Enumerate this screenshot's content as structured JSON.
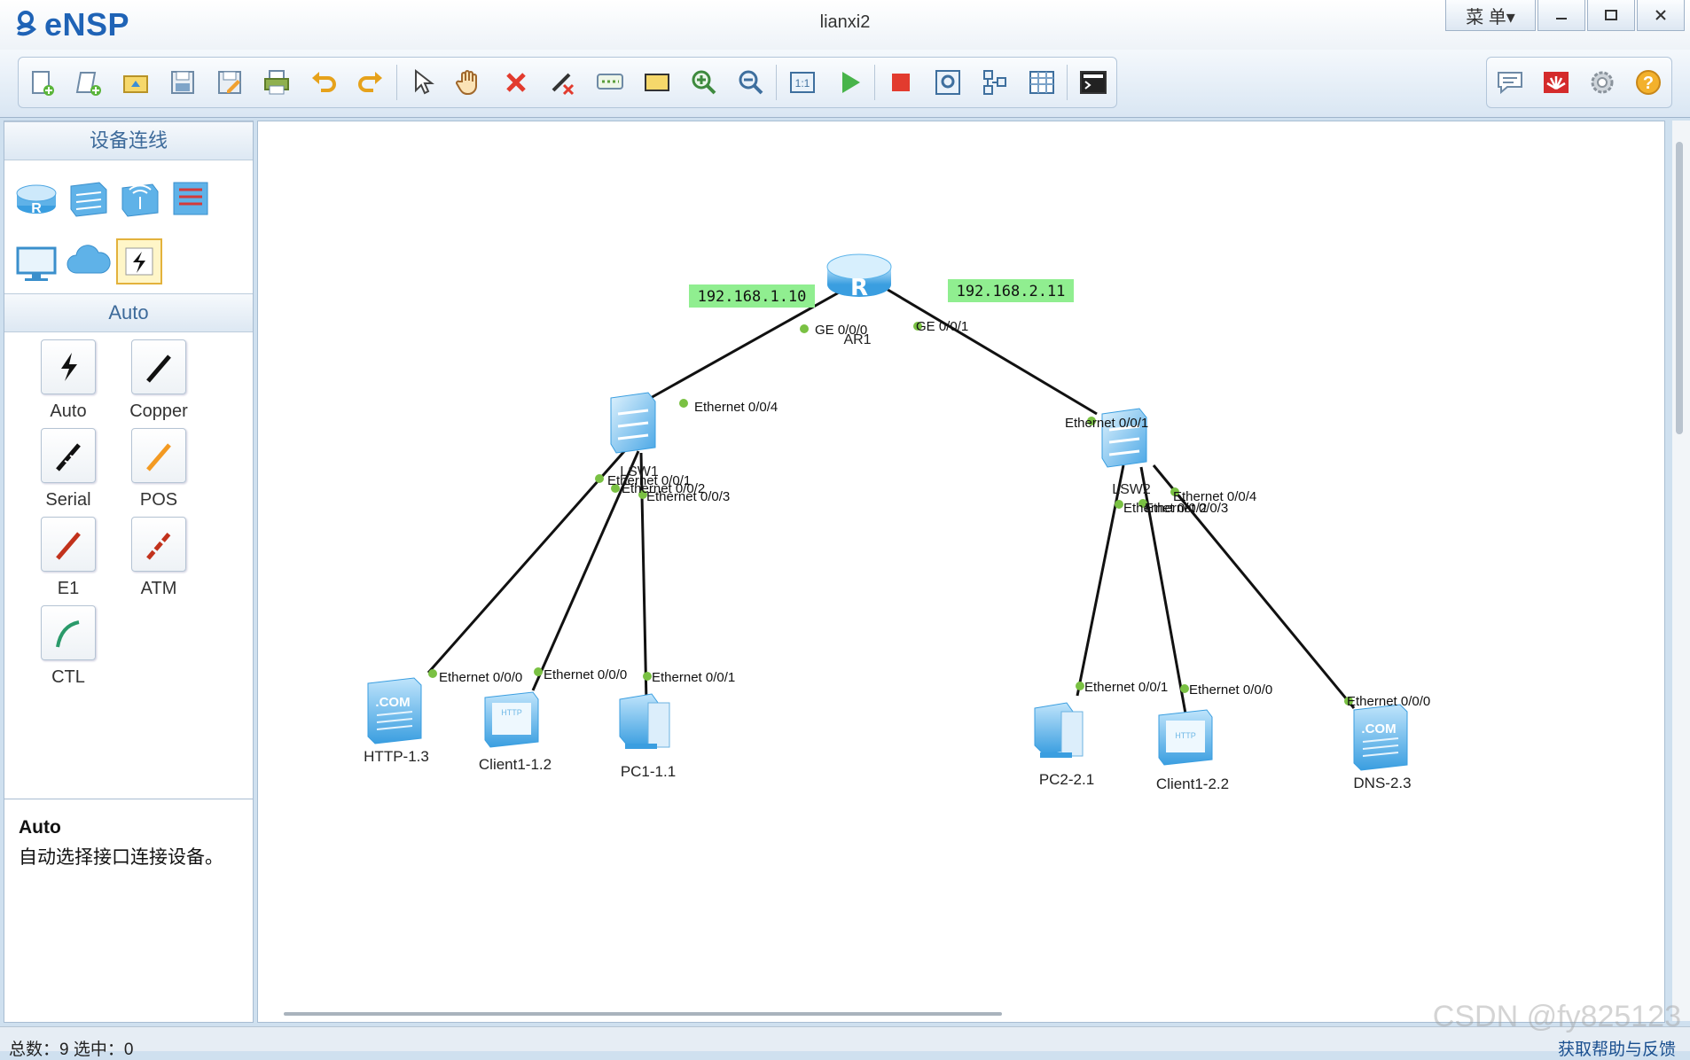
{
  "window": {
    "title": "lianxi2",
    "app_name": "eNSP",
    "menu_label": "菜 单▾"
  },
  "colors": {
    "accent": "#1f63b6",
    "ip_label_bg": "#90ee90",
    "link_dot": "#7ac143",
    "link_line": "#111111"
  },
  "toolbar": {
    "main_icons": [
      "new-topology-icon",
      "new-example-icon",
      "open-icon",
      "save-icon",
      "save-as-icon",
      "print-icon",
      "undo-icon",
      "redo-icon",
      "select-icon",
      "pan-hand-icon",
      "delete-icon",
      "delete-link-icon",
      "text-annotation-icon",
      "rectangle-icon",
      "zoom-in-icon",
      "zoom-out-icon",
      "fit-view-icon",
      "start-device-icon",
      "stop-device-icon",
      "capture-icon",
      "topology-view-icon",
      "grid-icon",
      "console-icon"
    ],
    "right_icons": [
      "chat-icon",
      "huawei-icon",
      "settings-icon",
      "help-icon"
    ]
  },
  "left_panel": {
    "device_header": "设备连线",
    "device_icons": [
      "router-icon",
      "switch-icon",
      "wireless-icon",
      "firewall-icon",
      "pc-terminal-icon",
      "cloud-icon",
      "link-auto-icon"
    ],
    "cable_header": "Auto",
    "cables": [
      {
        "label": "Auto",
        "icon": "auto-cable-icon"
      },
      {
        "label": "Copper",
        "icon": "copper-cable-icon"
      },
      {
        "label": "Serial",
        "icon": "serial-cable-icon"
      },
      {
        "label": "POS",
        "icon": "pos-cable-icon"
      },
      {
        "label": "E1",
        "icon": "e1-cable-icon"
      },
      {
        "label": "ATM",
        "icon": "atm-cable-icon"
      },
      {
        "label": "CTL",
        "icon": "ctl-cable-icon"
      }
    ],
    "description": {
      "title": "Auto",
      "text": "自动选择接口连接设备。"
    }
  },
  "topology": {
    "ip_labels": [
      "192.168.1.10",
      "192.168.2.11"
    ],
    "devices": {
      "ar1": {
        "name": "AR1",
        "type": "router"
      },
      "lsw1": {
        "name": "LSW1",
        "type": "switch"
      },
      "lsw2": {
        "name": "LSW2",
        "type": "switch"
      },
      "http": {
        "name": "HTTP-1.3",
        "type": "server"
      },
      "client11": {
        "name": "Client1-1.2",
        "type": "client"
      },
      "pc11": {
        "name": "PC1-1.1",
        "type": "pc"
      },
      "pc21": {
        "name": "PC2-2.1",
        "type": "pc"
      },
      "client22": {
        "name": "Client1-2.2",
        "type": "client"
      },
      "dns": {
        "name": "DNS-2.3",
        "type": "server"
      }
    },
    "ports": [
      "GE 0/0/0",
      "GE 0/0/1",
      "Ethernet 0/0/4",
      "Ethernet 0/0/1",
      "Ethernet 0/0/1",
      "Ethernet 0/0/2",
      "Ethernet 0/0/3",
      "Ethernet 0/0/0",
      "Ethernet 0/0/0",
      "Ethernet 0/0/1",
      "Ethernet 0/0/4",
      "Ethernet 0/0/2",
      "Ethernet 0/0/3",
      "Ethernet 0/0/1",
      "Ethernet 0/0/0",
      "Ethernet 0/0/0"
    ]
  },
  "status": {
    "text": "总数：9 选中：0",
    "help_link": "获取帮助与反馈"
  },
  "watermark": "CSDN @fy825123"
}
